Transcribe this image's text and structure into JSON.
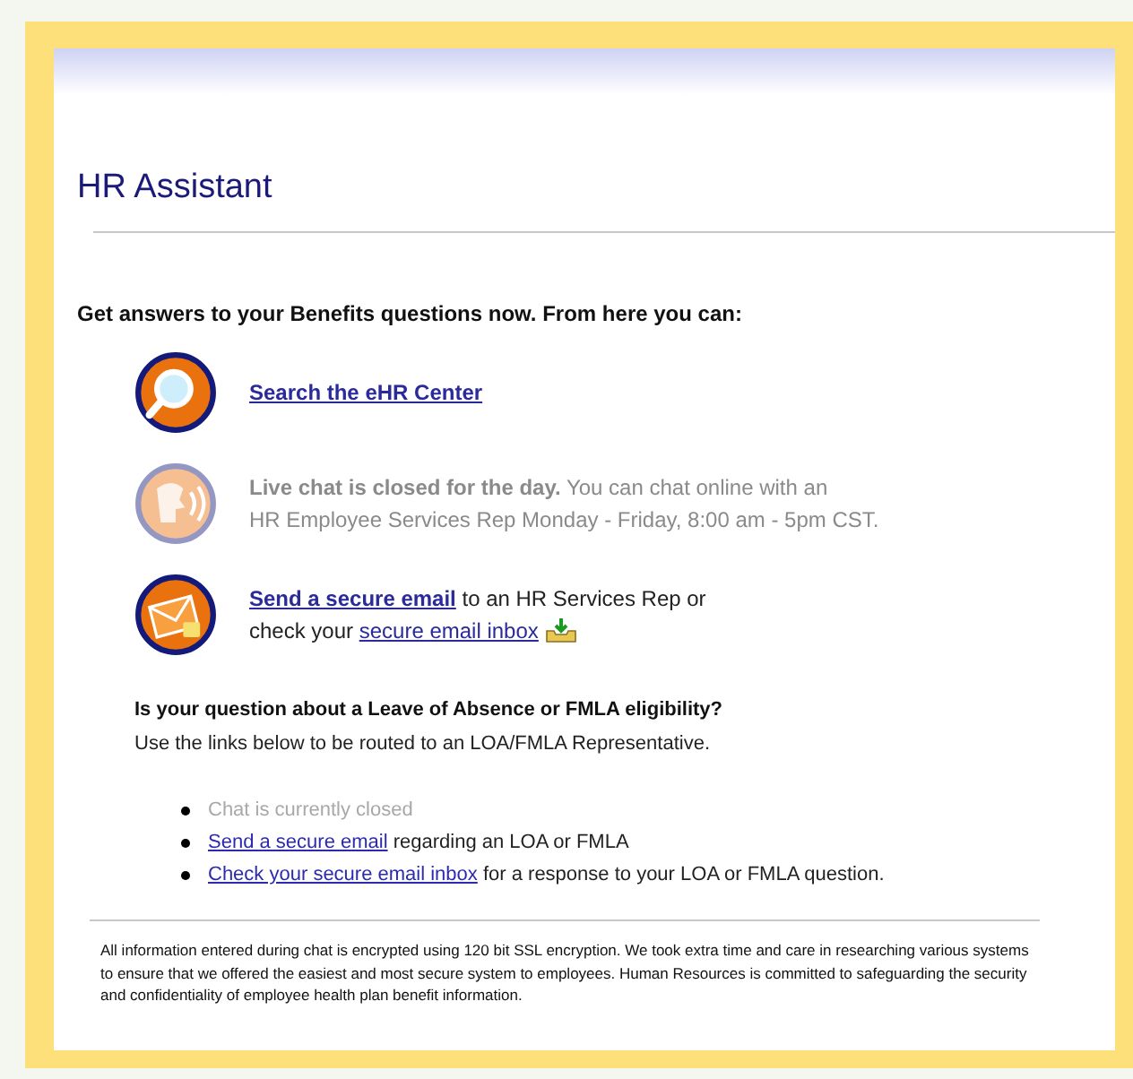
{
  "title": "HR Assistant",
  "intro": "Get answers to your Benefits questions now. From here you can:",
  "options": [
    {
      "kind": "search",
      "disabled": false,
      "lines": [
        [
          {
            "text": "Search the eHR Center",
            "link": true
          }
        ]
      ]
    },
    {
      "kind": "chat",
      "disabled": true,
      "lines": [
        [
          {
            "text": "**Live chat is closed for the day.** You can chat online with an",
            "link": false
          }
        ],
        [
          {
            "text": "HR Employee Services Rep Monday - Friday, 8:00 am - 5pm CST.",
            "link": false
          }
        ]
      ]
    },
    {
      "kind": "email",
      "disabled": false,
      "lines": [
        [
          {
            "text": "Send a secure email",
            "link": true
          },
          {
            "text": " to an HR Services Rep or",
            "link": false
          }
        ],
        [
          {
            "text": "check your ",
            "link": false
          },
          {
            "text": "secure email inbox",
            "link": true
          }
        ]
      ]
    }
  ],
  "loa": {
    "heading": "Is your question about a Leave of Absence or FMLA eligibility?",
    "subtext": "Use the links below to be routed to an LOA/FMLA Representative."
  },
  "bullets": [
    {
      "disabled": true,
      "parts": [
        {
          "text": "Chat is currently closed",
          "link": false
        }
      ]
    },
    {
      "disabled": false,
      "parts": [
        {
          "text": "Send a secure email",
          "link": true
        },
        {
          "text": " regarding an LOA or FMLA",
          "link": false
        }
      ]
    },
    {
      "disabled": false,
      "parts": [
        {
          "text": "Check your secure email inbox",
          "link": true
        },
        {
          "text": " for a response to your LOA or FMLA question.",
          "link": false
        }
      ]
    }
  ],
  "footer": "All information entered during chat is encrypted using 120 bit SSL encryption. We took extra time and care in researching various systems to ensure that we offered the easiest and most secure system to employees. Human Resources is committed to safeguarding the security and confidentiality of employee health plan benefit information."
}
